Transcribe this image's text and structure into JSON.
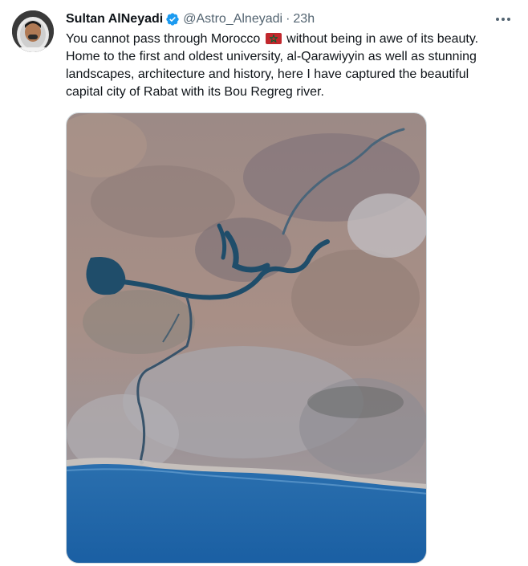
{
  "tweet": {
    "author_name": "Sultan AlNeyadi",
    "handle": "@Astro_Alneyadi",
    "separator": "·",
    "timestamp": "23h",
    "verified": true,
    "text_lines": [
      "You cannot pass through Morocco",
      "without being in awe of its beauty.",
      "Home to the first and oldest university, al-Qarawiyyin as well as stunning",
      "landscapes, architecture and history, here I have captured the beautiful",
      "capital city of Rabat with its Bou Regreg river."
    ],
    "emoji": "morocco-flag"
  },
  "icons": {
    "verified": "verified-badge-icon",
    "more": "more-horizontal-icon"
  },
  "colors": {
    "accent": "#1d9bf0",
    "text_primary": "#0f1419",
    "text_secondary": "#536471",
    "ocean": "#1565a8",
    "flag_red": "#c1272d",
    "flag_star": "#006233"
  }
}
